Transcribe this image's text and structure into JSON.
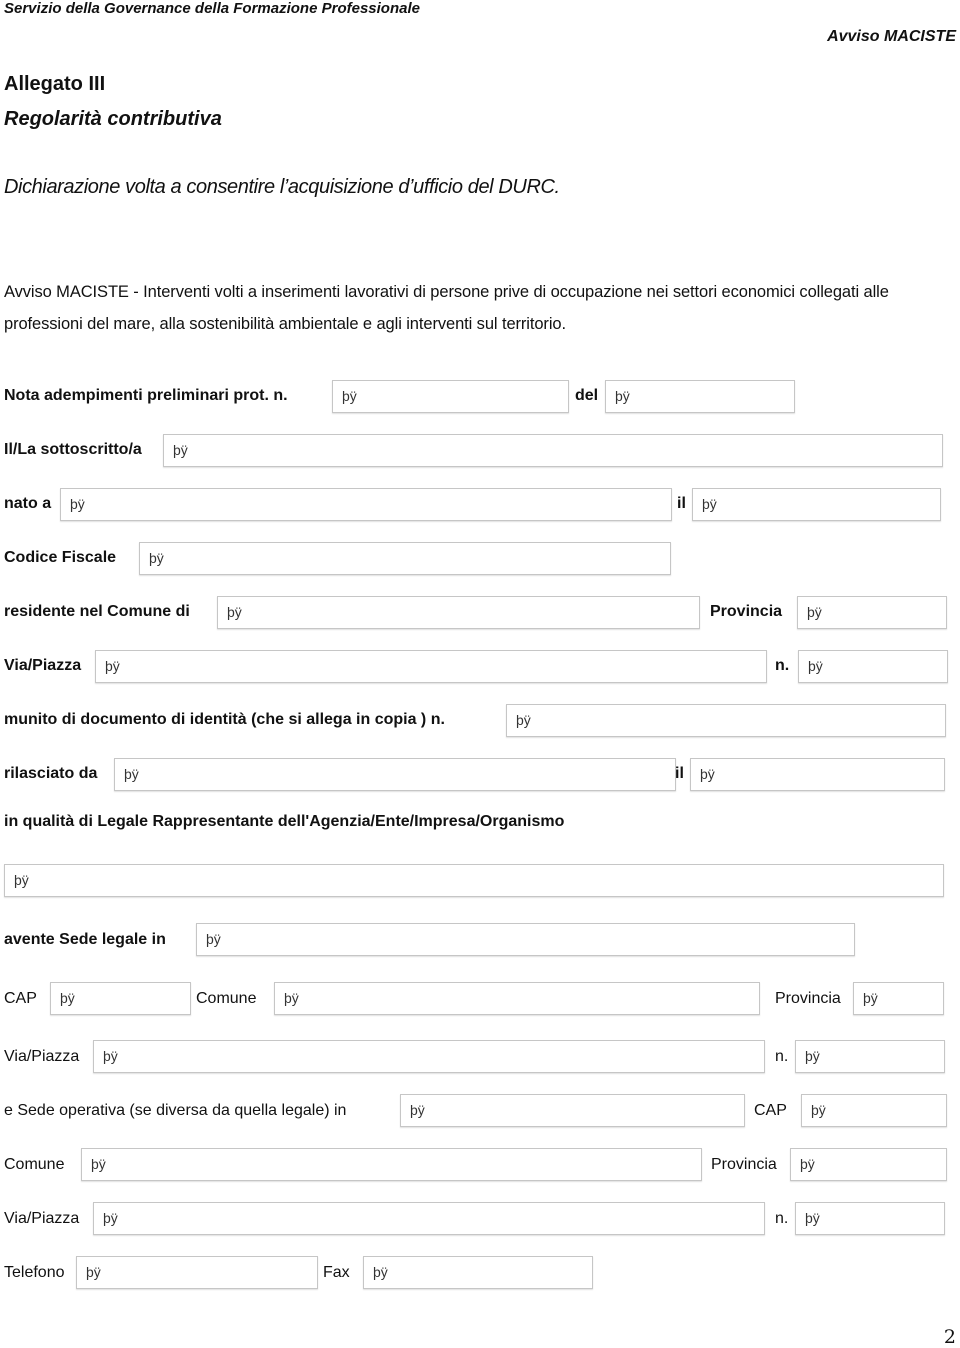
{
  "header": {
    "department": "Servizio della Governance della Formazione Professionale",
    "notice": "Avviso MACISTE"
  },
  "title": {
    "annex": "Allegato III",
    "subject": "Regolarità contributiva",
    "declaration": "Dichiarazione volta a consentire l’acquisizione d’ufficio del DURC."
  },
  "intro": "Avviso MACISTE - Interventi volti a inserimenti lavorativi di persone prive di occupazione nei settori economici collegati alle professioni del mare, alla sostenibilità ambientale e agli interventi sul territorio.",
  "field_placeholder": "þÿ",
  "form": {
    "prot_label": "Nota adempimenti preliminari prot. n.",
    "del_label": "del",
    "sottoscritto_label": "Il/La sottoscritto/a",
    "nato_label": "nato a",
    "il_label": "il",
    "cf_label": "Codice Fiscale",
    "residente_label": "residente nel Comune di",
    "provincia_label": "Provincia",
    "via_label": "Via/Piazza",
    "n_label": "n.",
    "documento_label": "munito di documento di identità (che si allega in copia ) n.",
    "rilasciato_label": "rilasciato da",
    "qualita_label": "in qualità di Legale Rappresentante dell'Agenzia/Ente/Impresa/Organismo",
    "sede_legale_label": "avente Sede legale in",
    "cap_label": "CAP",
    "comune_label": "Comune",
    "sede_operativa_label": "e Sede operativa (se diversa da quella legale) in",
    "telefono_label": "Telefono",
    "fax_label": "Fax"
  },
  "footer": {
    "page_number": "2"
  }
}
